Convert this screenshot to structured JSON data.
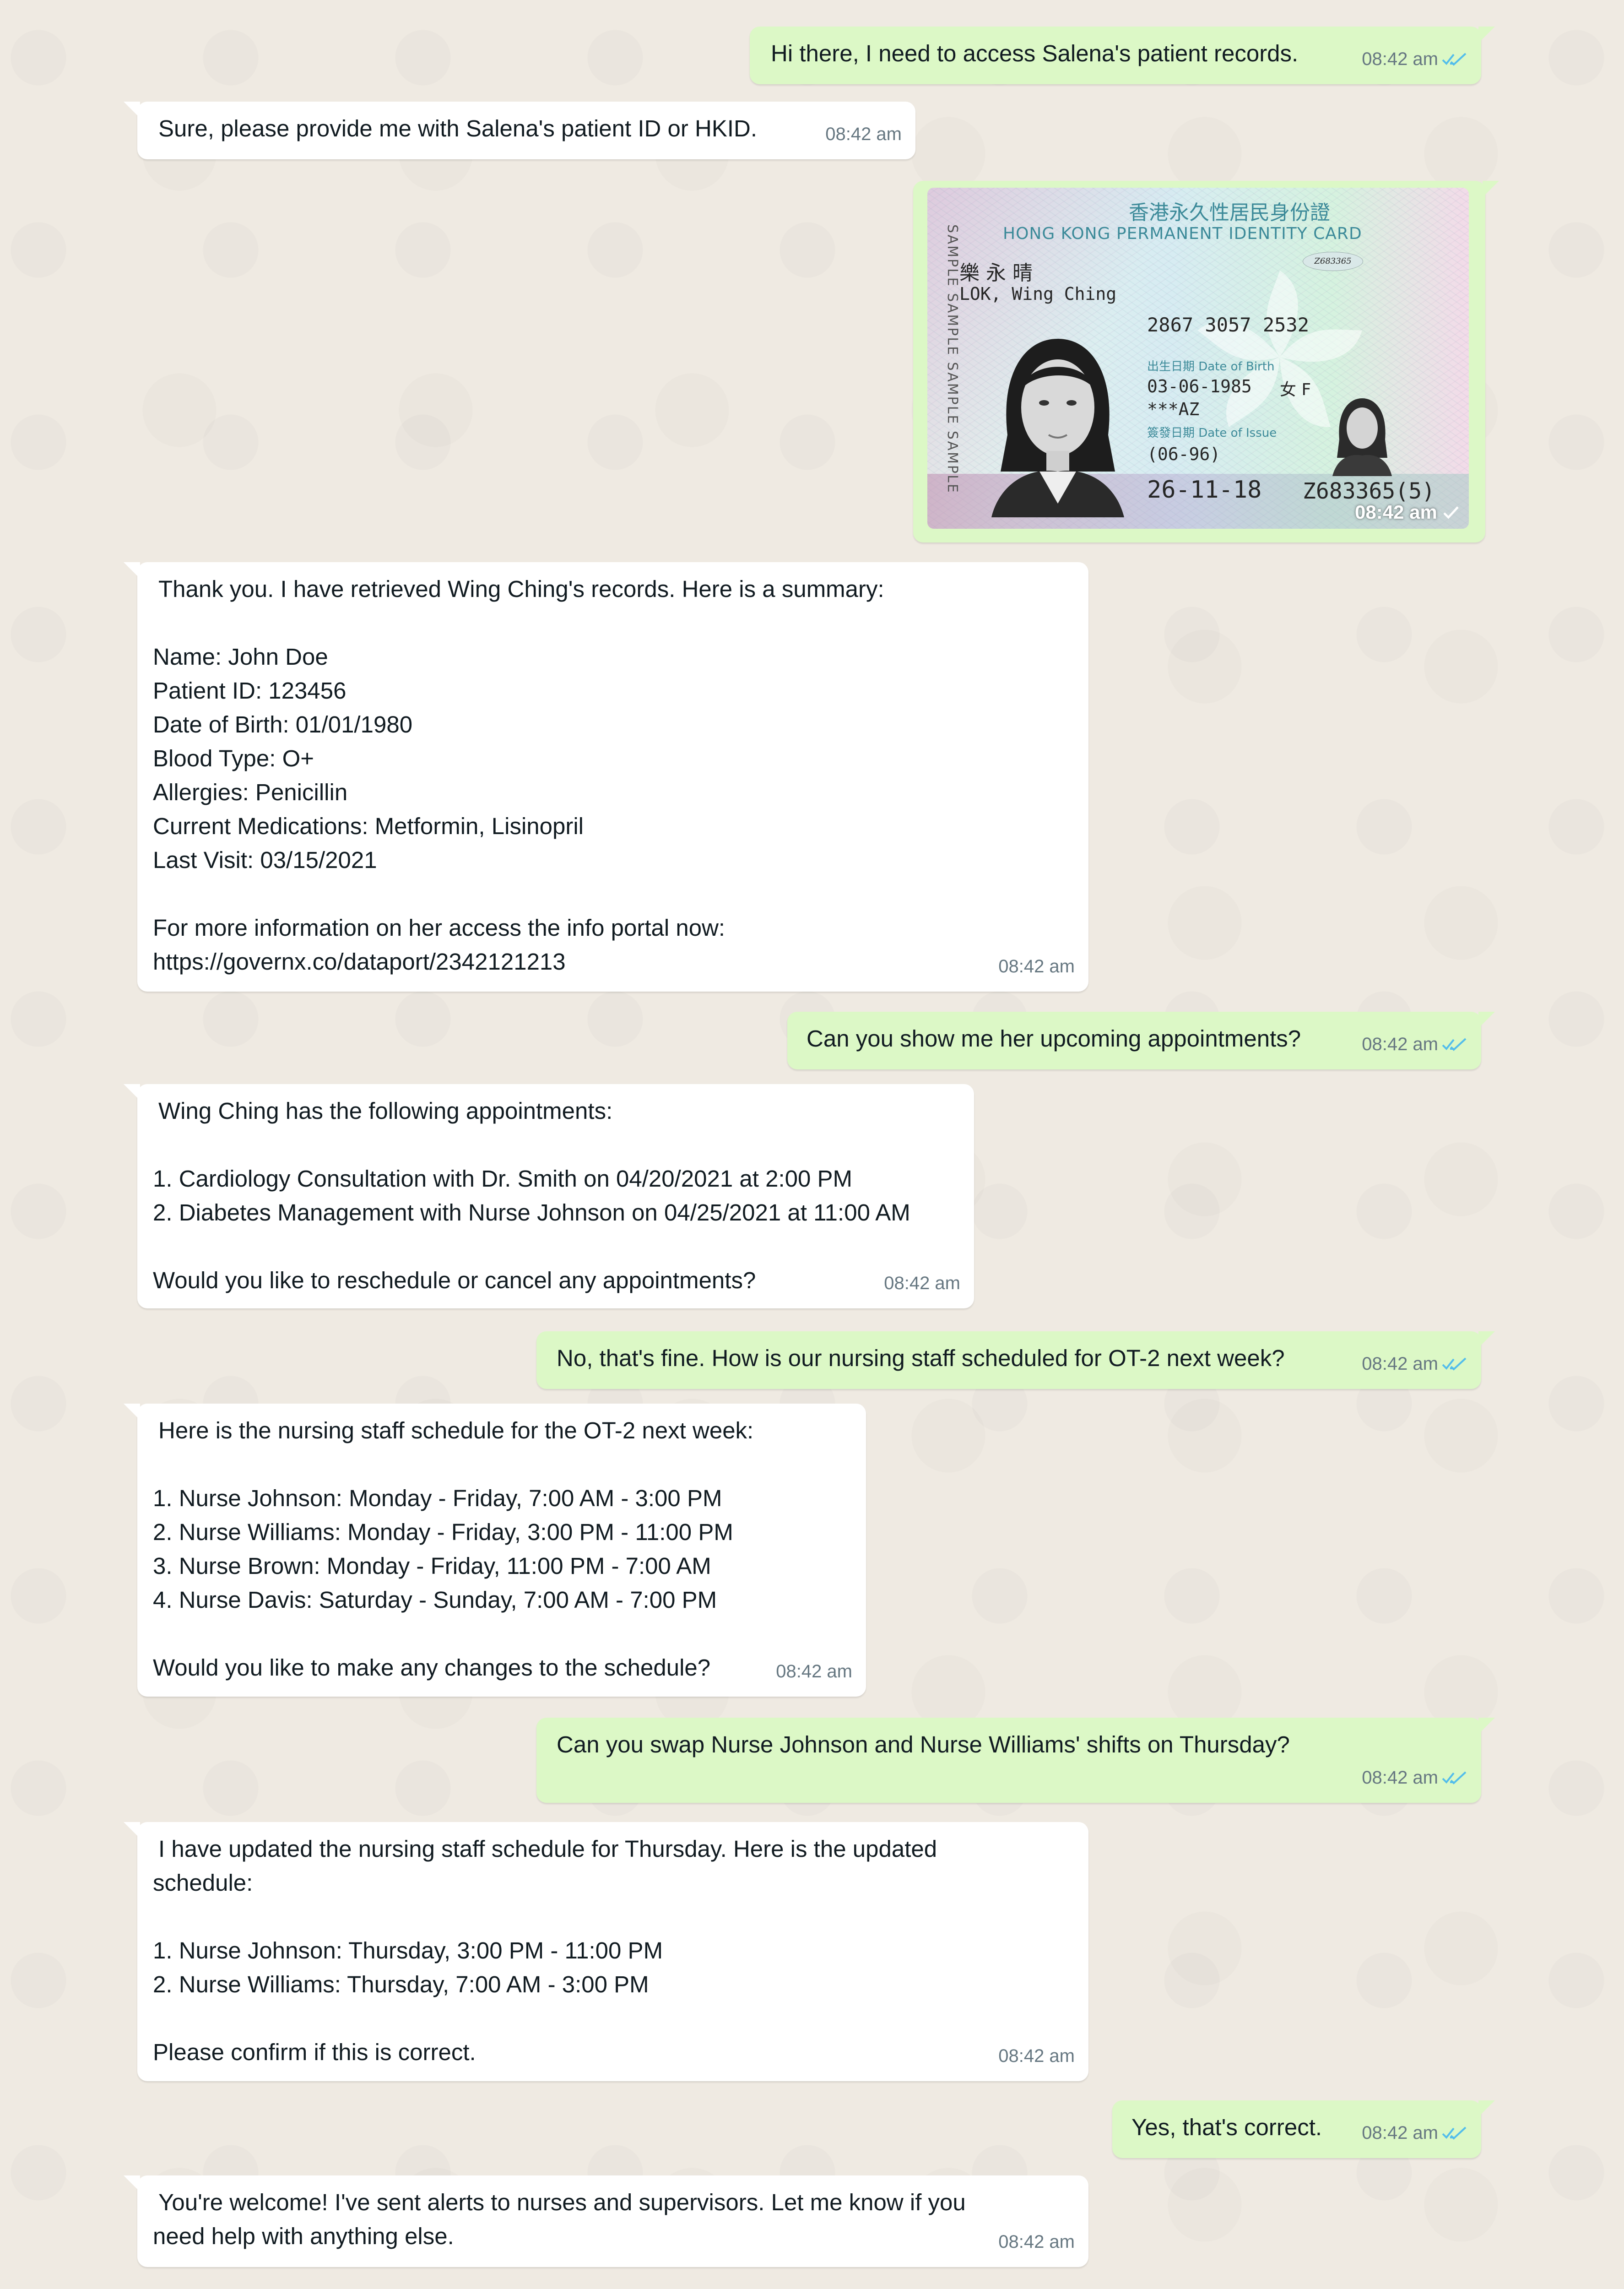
{
  "messages": [
    {
      "id": "m1",
      "dir": "out",
      "lines": [
        "Hi there, I need to access Salena's patient records."
      ],
      "time": "08:42 am"
    },
    {
      "id": "m2",
      "dir": "in",
      "lines": [
        "Sure, please provide me with Salena's patient ID or HKID."
      ],
      "time": "08:42 am"
    },
    {
      "id": "m3",
      "dir": "out",
      "image": "hkid-card",
      "time": "08:42 am"
    },
    {
      "id": "m4",
      "dir": "in",
      "lines": [
        "Thank you. I have retrieved Wing Ching's records. Here is a summary:",
        "",
        "Name: John Doe",
        "Patient ID: 123456",
        "Date of Birth: 01/01/1980",
        "Blood Type: O+",
        "Allergies: Penicillin",
        "Current Medications: Metformin, Lisinopril",
        "Last Visit: 03/15/2021",
        "",
        "For more information on her access the info portal now:",
        "https://governx.co/dataport/2342121213"
      ],
      "time": "08:42 am"
    },
    {
      "id": "m5",
      "dir": "out",
      "lines": [
        "Can you show me her upcoming appointments?"
      ],
      "time": "08:42 am"
    },
    {
      "id": "m6",
      "dir": "in",
      "lines": [
        "Wing Ching has the following appointments:",
        "",
        "1. Cardiology Consultation with Dr. Smith on 04/20/2021 at 2:00 PM",
        "2. Diabetes Management with Nurse Johnson on 04/25/2021 at 11:00 AM",
        "",
        "Would you like to reschedule or cancel any appointments?"
      ],
      "time": "08:42 am"
    },
    {
      "id": "m7",
      "dir": "out",
      "lines": [
        "No, that's fine. How is our nursing staff scheduled for OT-2 next week?"
      ],
      "time": "08:42 am"
    },
    {
      "id": "m8",
      "dir": "in",
      "lines": [
        "Here is the nursing staff schedule for the OT-2 next week:",
        "",
        "1. Nurse Johnson: Monday - Friday, 7:00 AM - 3:00 PM",
        "2. Nurse Williams: Monday - Friday, 3:00 PM - 11:00 PM",
        "3. Nurse Brown: Monday - Friday, 11:00 PM - 7:00 AM",
        "4. Nurse Davis: Saturday - Sunday, 7:00 AM - 7:00 PM",
        "",
        "Would you like to make any changes to the schedule?"
      ],
      "time": "08:42 am"
    },
    {
      "id": "m9",
      "dir": "out",
      "lines": [
        "Can you swap Nurse Johnson and Nurse Williams' shifts on Thursday?"
      ],
      "time": "08:42 am"
    },
    {
      "id": "m10",
      "dir": "in",
      "lines": [
        "I have updated the nursing staff schedule for Thursday. Here is the updated",
        "schedule:",
        "",
        "1. Nurse Johnson: Thursday, 3:00 PM - 11:00 PM",
        "2. Nurse Williams: Thursday, 7:00 AM - 3:00 PM",
        "",
        "Please confirm if this is correct."
      ],
      "time": "08:42 am"
    },
    {
      "id": "m11",
      "dir": "out",
      "lines": [
        "Yes, that's correct."
      ],
      "time": "08:42 am"
    },
    {
      "id": "m12",
      "dir": "in",
      "lines": [
        "You're welcome! I've sent alerts to nurses and supervisors. Let me know if you",
        "need help with anything else."
      ],
      "time": "08:42 am"
    }
  ],
  "id_card": {
    "title_zh": "香港永久性居民身份證",
    "title_en": "HONG KONG PERMANENT IDENTITY CARD",
    "name_zh": "樂 永 晴",
    "name_en": "LOK, Wing Ching",
    "serial": "Z683365",
    "ccc": "2867 3057 2532",
    "dob_label": "出生日期 Date of Birth",
    "dob": "03-06-1985",
    "sex": "女 F",
    "symbols": "***AZ",
    "doi_label": "簽發日期 Date of Issue",
    "first_issue": "(06-96)",
    "issue_date": "26-11-18",
    "id_number": "Z683365(5)",
    "sample_text": "SAMPLE  SAMPLE  SAMPLE  SAMPLE"
  },
  "colors": {
    "incoming": "#ffffff",
    "outgoing": "#dcf8c6",
    "tick": "#53bdeb",
    "time": "#667781",
    "background": "#efeae2"
  },
  "icons": {
    "read_receipt": "double-check-icon",
    "sent_receipt": "single-check-icon"
  }
}
